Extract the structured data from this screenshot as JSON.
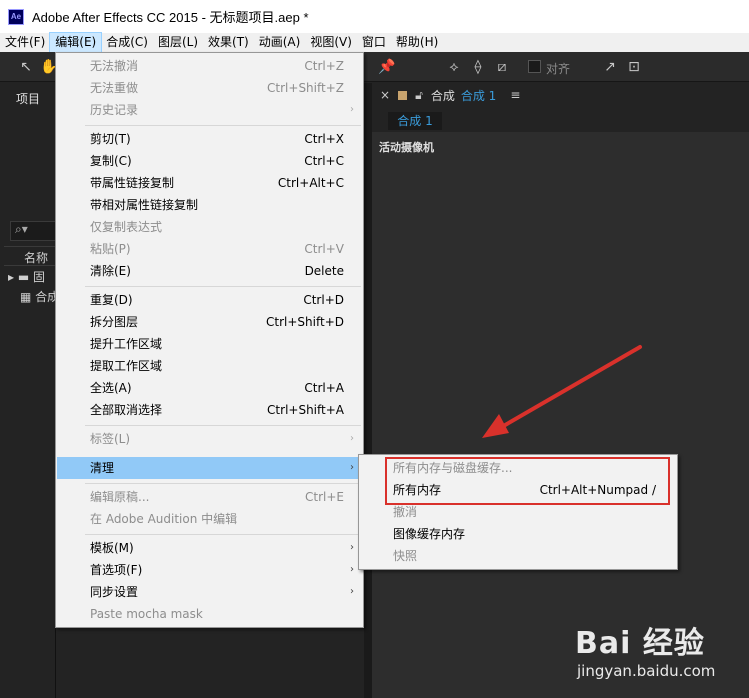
{
  "window": {
    "icon_text": "Ae",
    "title": "Adobe After Effects CC 2015 - 无标题项目.aep *"
  },
  "menubar": {
    "items": [
      {
        "label": "文件(F)",
        "active": false
      },
      {
        "label": "编辑(E)",
        "active": true
      },
      {
        "label": "合成(C)",
        "active": false
      },
      {
        "label": "图层(L)",
        "active": false
      },
      {
        "label": "效果(T)",
        "active": false
      },
      {
        "label": "动画(A)",
        "active": false
      },
      {
        "label": "视图(V)",
        "active": false
      },
      {
        "label": "窗口",
        "active": false
      },
      {
        "label": "帮助(H)",
        "active": false
      }
    ]
  },
  "toolbar": {
    "snap_label": "对齐"
  },
  "project_panel": {
    "tab_label": "项目",
    "search_icon_text": "⌕▾",
    "name_column": "名称",
    "row_folder": "固",
    "row_comp": "合成"
  },
  "comp_panel": {
    "close_glyph": "×",
    "tab_prefix": "合成",
    "tab_name": "合成 1",
    "menu_glyph": "≡",
    "subtab": "合成 1",
    "camera_label": "活动摄像机"
  },
  "edit_menu": {
    "items": [
      {
        "label": "无法撤消",
        "shortcut": "Ctrl+Z",
        "disabled": true
      },
      {
        "label": "无法重做",
        "shortcut": "Ctrl+Shift+Z",
        "disabled": true
      },
      {
        "label": "历史记录",
        "shortcut": "",
        "disabled": true,
        "submenu": true
      },
      {
        "label": "剪切(T)",
        "shortcut": "Ctrl+X",
        "disabled": false
      },
      {
        "label": "复制(C)",
        "shortcut": "Ctrl+C",
        "disabled": false
      },
      {
        "label": "带属性链接复制",
        "shortcut": "Ctrl+Alt+C",
        "disabled": false
      },
      {
        "label": "带相对属性链接复制",
        "shortcut": "",
        "disabled": false
      },
      {
        "label": "仅复制表达式",
        "shortcut": "",
        "disabled": true
      },
      {
        "label": "粘贴(P)",
        "shortcut": "Ctrl+V",
        "disabled": true
      },
      {
        "label": "清除(E)",
        "shortcut": "Delete",
        "disabled": false
      },
      {
        "label": "重复(D)",
        "shortcut": "Ctrl+D",
        "disabled": false
      },
      {
        "label": "拆分图层",
        "shortcut": "Ctrl+Shift+D",
        "disabled": false
      },
      {
        "label": "提升工作区域",
        "shortcut": "",
        "disabled": false
      },
      {
        "label": "提取工作区域",
        "shortcut": "",
        "disabled": false
      },
      {
        "label": "全选(A)",
        "shortcut": "Ctrl+A",
        "disabled": false
      },
      {
        "label": "全部取消选择",
        "shortcut": "Ctrl+Shift+A",
        "disabled": false
      },
      {
        "label": "标签(L)",
        "shortcut": "",
        "disabled": true,
        "submenu": true
      },
      {
        "label": "清理",
        "shortcut": "",
        "disabled": false,
        "submenu": true,
        "highlight": true
      },
      {
        "label": "编辑原稿...",
        "shortcut": "Ctrl+E",
        "disabled": true
      },
      {
        "label": "在 Adobe Audition 中编辑",
        "shortcut": "",
        "disabled": true
      },
      {
        "label": "模板(M)",
        "shortcut": "",
        "disabled": false,
        "submenu": true
      },
      {
        "label": "首选项(F)",
        "shortcut": "",
        "disabled": false,
        "submenu": true
      },
      {
        "label": "同步设置",
        "shortcut": "",
        "disabled": false,
        "submenu": true
      },
      {
        "label": "Paste mocha mask",
        "shortcut": "",
        "disabled": true
      }
    ],
    "arrow_glyph": "›"
  },
  "purge_submenu": {
    "items": [
      {
        "label": "所有内存与磁盘缓存...",
        "shortcut": "",
        "disabled": true
      },
      {
        "label": "所有内存",
        "shortcut": "Ctrl+Alt+Numpad /",
        "disabled": false
      },
      {
        "label": "撤消",
        "shortcut": "",
        "disabled": true
      },
      {
        "label": "图像缓存内存",
        "shortcut": "",
        "disabled": false
      },
      {
        "label": "快照",
        "shortcut": "",
        "disabled": true
      }
    ]
  },
  "watermark": {
    "logo": "Bai 经验",
    "url": "jingyan.baidu.com"
  },
  "colors": {
    "highlight": "#91c9f7",
    "annotation_red": "#d9312b",
    "comp_blue": "#3a9bd9"
  }
}
